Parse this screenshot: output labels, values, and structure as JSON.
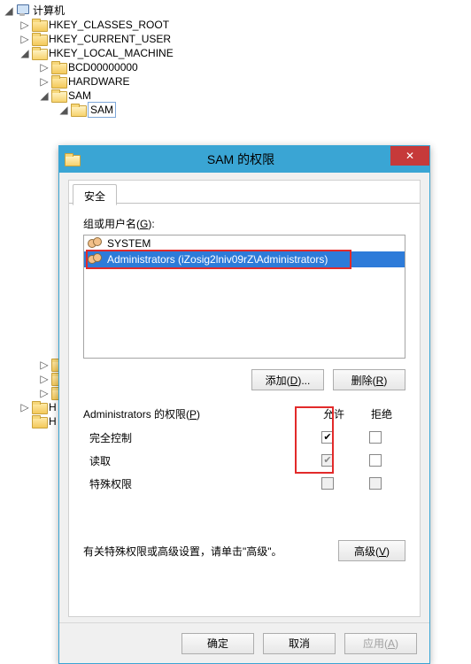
{
  "tree": {
    "root": "计算机",
    "items": [
      "HKEY_CLASSES_ROOT",
      "HKEY_CURRENT_USER",
      "HKEY_LOCAL_MACHINE",
      "BCD00000000",
      "HARDWARE",
      "SAM",
      "SAM",
      "H",
      "H"
    ]
  },
  "dialog": {
    "title": "SAM 的权限",
    "tab_label": "安全",
    "group_label": "组或用户名(G):",
    "users": [
      {
        "name": "SYSTEM"
      },
      {
        "name": "Administrators (iZosig2lniv09rZ\\Administrators)"
      }
    ],
    "add_label": "添加(D)...",
    "remove_label": "删除(R)",
    "perm_label": "Administrators 的权限(P)",
    "allow_label": "允许",
    "deny_label": "拒绝",
    "perms": [
      {
        "name": "完全控制",
        "allow": true,
        "deny": false,
        "editable": true
      },
      {
        "name": "读取",
        "allow": true,
        "deny": false,
        "editable": true
      },
      {
        "name": "特殊权限",
        "allow": false,
        "deny": false,
        "editable": false
      }
    ],
    "note": "有关特殊权限或高级设置，请单击\"高级\"。",
    "advanced_label": "高级(V)",
    "ok_label": "确定",
    "cancel_label": "取消",
    "apply_label": "应用(A)"
  }
}
